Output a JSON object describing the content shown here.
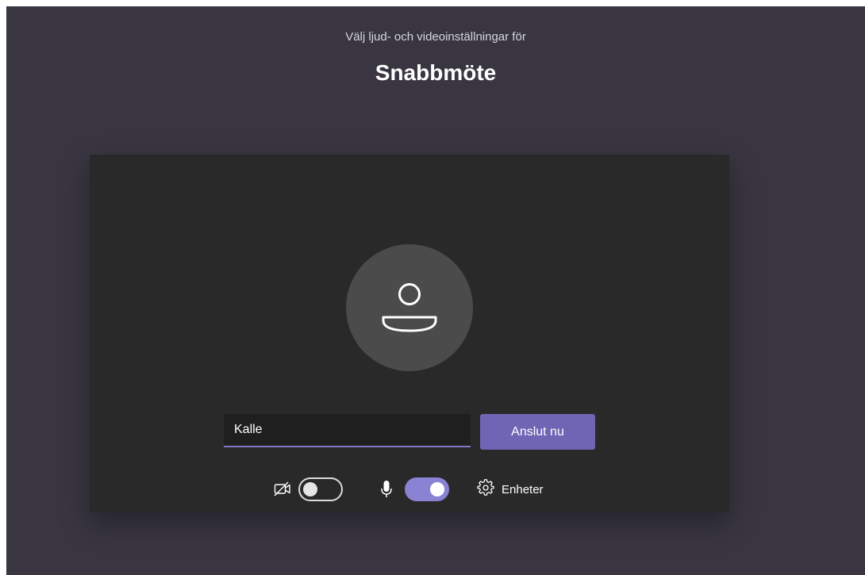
{
  "header": {
    "subtitle": "Välj ljud- och videoinställningar för",
    "title": "Snabbmöte"
  },
  "prejoin": {
    "avatar_icon": "person-icon",
    "name_input": {
      "value": "Kalle",
      "placeholder": ""
    },
    "join_button_label": "Anslut nu"
  },
  "controls": {
    "camera": {
      "icon": "camera-off-icon",
      "enabled": false
    },
    "microphone": {
      "icon": "microphone-icon",
      "enabled": true
    },
    "devices": {
      "icon": "gear-icon",
      "label": "Enheter"
    }
  },
  "colors": {
    "background": "#393642",
    "preview_background": "#292929",
    "accent": "#6f65b4",
    "toggle_on": "#8a82d3"
  }
}
